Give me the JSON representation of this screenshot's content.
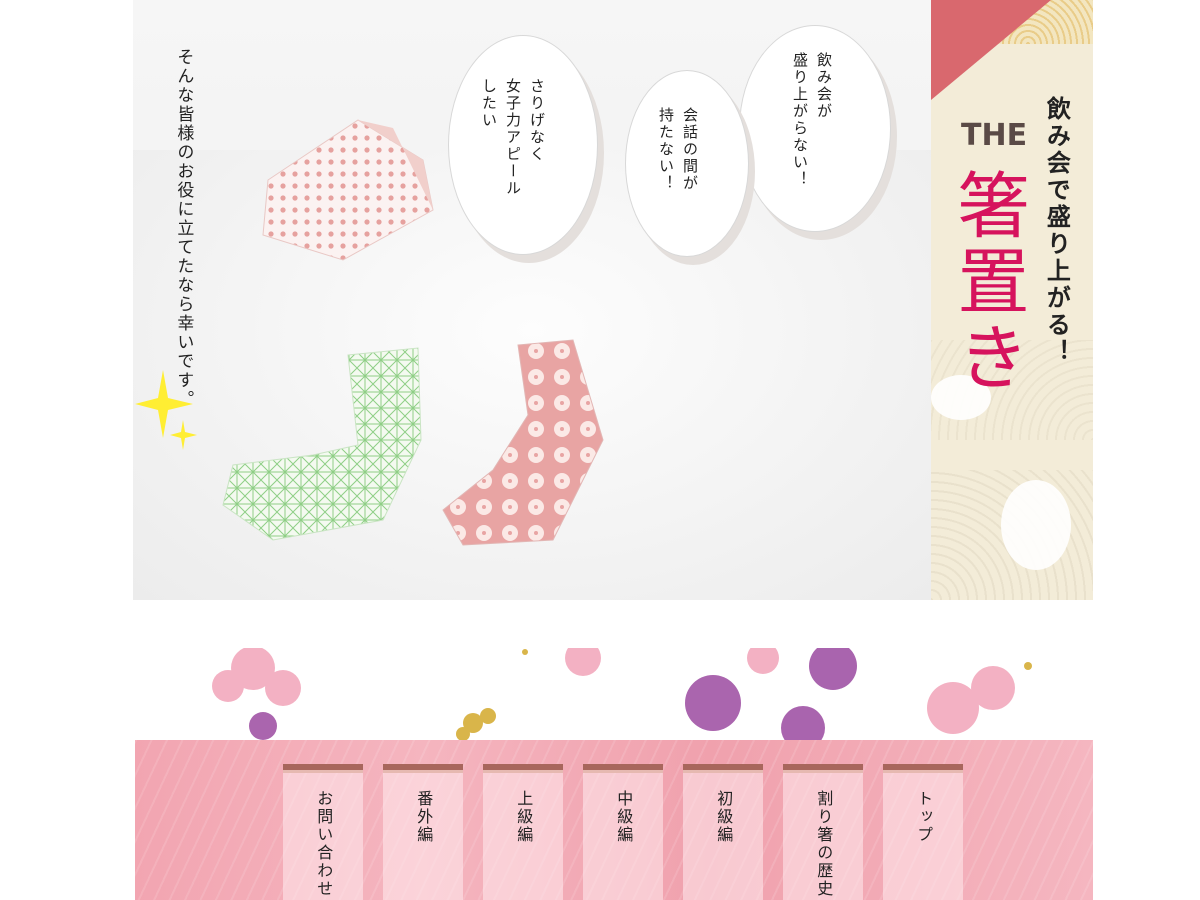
{
  "hero": {
    "tagline": "そんな皆様のお役に立てたなら幸いです。",
    "bubbles": [
      "飲み会が\n盛り上がらない！",
      "会話の間が\n持たない！",
      "さりげなく\n女子力アピール\nしたい"
    ]
  },
  "title": {
    "subtitle": "飲み会で盛り上がる！",
    "the": "THE",
    "main": "箸置き"
  },
  "nav": {
    "items": [
      {
        "label": "トップ"
      },
      {
        "label": "割り箸の歴史"
      },
      {
        "label": "初級編"
      },
      {
        "label": "中級編"
      },
      {
        "label": "上級編"
      },
      {
        "label": "番外編"
      },
      {
        "label": "お問い合わせ"
      }
    ]
  },
  "colors": {
    "accent": "#d6135d",
    "nav_bg": "#f2a5b1",
    "nav_top_border": "#a8665c"
  }
}
